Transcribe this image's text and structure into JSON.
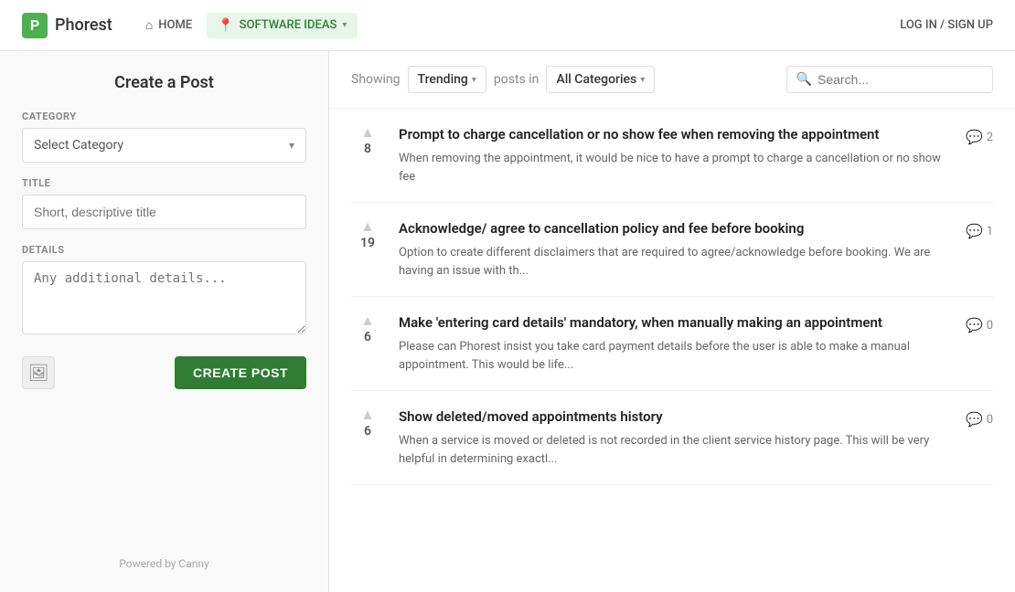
{
  "header": {
    "logo_char": "P",
    "app_name": "Phorest",
    "nav": {
      "home_label": "HOME",
      "software_ideas_label": "SOFTWARE IDEAS",
      "auth_label": "LOG IN / SIGN UP"
    }
  },
  "left_panel": {
    "title": "Create a Post",
    "category_label": "CATEGORY",
    "category_placeholder": "Select Category",
    "title_label": "TITLE",
    "title_placeholder": "Short, descriptive title",
    "details_label": "DETAILS",
    "details_placeholder": "Any additional details...",
    "create_button_label": "CREATE POST",
    "powered_by": "Powered by Canny"
  },
  "filter_bar": {
    "showing_label": "Showing",
    "trending_label": "Trending",
    "posts_in_label": "posts in",
    "all_categories_label": "All Categories",
    "search_placeholder": "Search..."
  },
  "posts": [
    {
      "id": 1,
      "votes": 8,
      "title": "Prompt to charge cancellation or no show fee when removing the appointment",
      "excerpt": "When removing the appointment, it would be nice to have a prompt to charge a cancellation or no show fee",
      "comments": 2
    },
    {
      "id": 2,
      "votes": 19,
      "title": "Acknowledge/ agree to cancellation policy and fee before booking",
      "excerpt": "Option to create different disclaimers that are required to agree/acknowledge before booking. We are having an issue with th...",
      "comments": 1
    },
    {
      "id": 3,
      "votes": 6,
      "title": "Make 'entering card details' mandatory, when manually making an appointment",
      "excerpt": "Please can Phorest insist you take card payment details before the user is able to make a manual appointment. This would be life...",
      "comments": 0
    },
    {
      "id": 4,
      "votes": 6,
      "title": "Show deleted/moved appointments history",
      "excerpt": "When a service is moved or deleted is not recorded in the client service history page. This will be very helpful in determining exactl...",
      "comments": 0
    }
  ]
}
